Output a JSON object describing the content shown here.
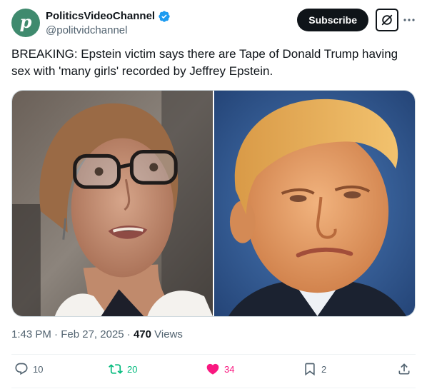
{
  "author": {
    "avatar_letter": "p",
    "display_name": "PoliticsVideoChannel",
    "handle": "@politvidchannel"
  },
  "header": {
    "subscribe_label": "Subscribe"
  },
  "tweet": {
    "text": "BREAKING: Epstein victim says there are Tape of Donald Trump having sex with 'many girls' recorded by Jeffrey Epstein."
  },
  "meta": {
    "time": "1:43 PM",
    "date": "Feb 27, 2025",
    "views_count": "470",
    "views_label": "Views"
  },
  "actions": {
    "replies": "10",
    "reposts": "20",
    "likes": "34",
    "bookmarks": "2"
  },
  "colors": {
    "repost": "#00ba7c",
    "like": "#f91880",
    "verified": "#1d9bf0",
    "avatar_bg": "#3f8a6e"
  }
}
